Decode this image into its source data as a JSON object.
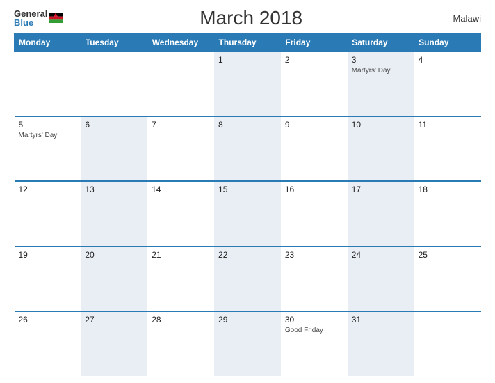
{
  "header": {
    "logo_general": "General",
    "logo_blue": "Blue",
    "title": "March 2018",
    "country": "Malawi"
  },
  "days": [
    "Monday",
    "Tuesday",
    "Wednesday",
    "Thursday",
    "Friday",
    "Saturday",
    "Sunday"
  ],
  "weeks": [
    [
      {
        "date": "",
        "event": ""
      },
      {
        "date": "",
        "event": ""
      },
      {
        "date": "",
        "event": ""
      },
      {
        "date": "1",
        "event": ""
      },
      {
        "date": "2",
        "event": ""
      },
      {
        "date": "3",
        "event": "Martyrs' Day"
      },
      {
        "date": "4",
        "event": ""
      }
    ],
    [
      {
        "date": "5",
        "event": "Martyrs' Day"
      },
      {
        "date": "6",
        "event": ""
      },
      {
        "date": "7",
        "event": ""
      },
      {
        "date": "8",
        "event": ""
      },
      {
        "date": "9",
        "event": ""
      },
      {
        "date": "10",
        "event": ""
      },
      {
        "date": "11",
        "event": ""
      }
    ],
    [
      {
        "date": "12",
        "event": ""
      },
      {
        "date": "13",
        "event": ""
      },
      {
        "date": "14",
        "event": ""
      },
      {
        "date": "15",
        "event": ""
      },
      {
        "date": "16",
        "event": ""
      },
      {
        "date": "17",
        "event": ""
      },
      {
        "date": "18",
        "event": ""
      }
    ],
    [
      {
        "date": "19",
        "event": ""
      },
      {
        "date": "20",
        "event": ""
      },
      {
        "date": "21",
        "event": ""
      },
      {
        "date": "22",
        "event": ""
      },
      {
        "date": "23",
        "event": ""
      },
      {
        "date": "24",
        "event": ""
      },
      {
        "date": "25",
        "event": ""
      }
    ],
    [
      {
        "date": "26",
        "event": ""
      },
      {
        "date": "27",
        "event": ""
      },
      {
        "date": "28",
        "event": ""
      },
      {
        "date": "29",
        "event": ""
      },
      {
        "date": "30",
        "event": "Good Friday"
      },
      {
        "date": "31",
        "event": ""
      },
      {
        "date": "",
        "event": ""
      }
    ]
  ]
}
